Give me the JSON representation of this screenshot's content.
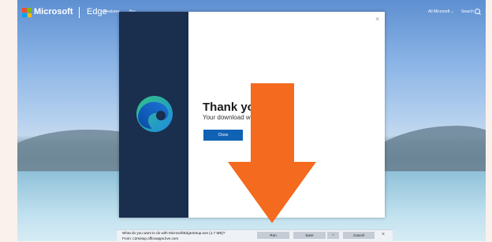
{
  "nav": {
    "brand": "Microsoft",
    "product": "Edge",
    "features": "Features",
    "browse": "Bro",
    "all_microsoft": "All Microsoft ⌄",
    "search": "Search"
  },
  "modal": {
    "title": "Thank you",
    "subtitle": "Your download w",
    "close_button": "Close",
    "close_x": "×"
  },
  "download_bar": {
    "question": "What do you want to do with MicrosoftEdgeSetup.exe (1.7 MB)?",
    "from": "From: c2rsetup.officeapps.live.com",
    "run": "Run",
    "save": "Save",
    "more": "^",
    "cancel": "Cancel",
    "close": "×"
  },
  "colors": {
    "accent": "#0f62b4",
    "arrow": "#f46a1e",
    "modal_side": "#1a2e4d"
  }
}
